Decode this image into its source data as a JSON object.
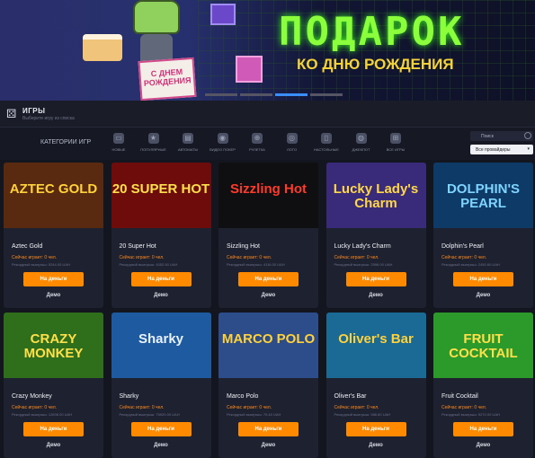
{
  "banner": {
    "title": "ПОДАРОК",
    "subtitle": "КО ДНЮ РОЖДЕНИЯ",
    "card_text": "С ДНЕМ РОЖДЕНИЯ",
    "slide_count": 4,
    "active_slide": 2
  },
  "games_section": {
    "title": "ИГРЫ",
    "subtitle": "Выберите игру из списка"
  },
  "categories": {
    "label": "КАТЕГОРИИ ИГР",
    "items": [
      {
        "label": "НОВЫЕ",
        "icon": "tv-icon"
      },
      {
        "label": "ПОПУЛЯРНЫЕ",
        "icon": "star-icon"
      },
      {
        "label": "АВТОМАТЫ",
        "icon": "slot-machine-icon"
      },
      {
        "label": "ВИДЕО ПОКЕР",
        "icon": "poker-chip-icon"
      },
      {
        "label": "РУЛЕТКА",
        "icon": "roulette-icon"
      },
      {
        "label": "ЛОТО",
        "icon": "lotto-icon"
      },
      {
        "label": "НАСТОЛЬНЫЕ",
        "icon": "card-icon"
      },
      {
        "label": "ДЖЕКПОТ",
        "icon": "jackpot-icon"
      },
      {
        "label": "ВСЕ ИГРЫ",
        "icon": "all-games-icon"
      }
    ]
  },
  "search": {
    "placeholder": "Поиск"
  },
  "providers": {
    "selected": "Все провайдеры"
  },
  "game_labels": {
    "playing_prefix": "Сейчас играет: 0 чел.",
    "play_for_money": "На деньги",
    "demo": "Демо"
  },
  "games": [
    {
      "name": "Aztec Gold",
      "logo": "AZTEC GOLD",
      "record": "Рекордный выигрыш: 5244.00 UAH",
      "bg": "#5a2a10",
      "logo_color": "#ffd23a"
    },
    {
      "name": "20 Super Hot",
      "logo": "20 SUPER HOT",
      "record": "Рекордный выигрыш: 4052.50 UAH",
      "bg": "#6e0c0c",
      "logo_color": "#ffe04a"
    },
    {
      "name": "Sizzling Hot",
      "logo": "Sizzling Hot",
      "record": "Рекордный выигрыш: 4116.00 UAH",
      "bg": "#0f0f12",
      "logo_color": "#ff3a2a"
    },
    {
      "name": "Lucky Lady's Charm",
      "logo": "Lucky Lady's Charm",
      "record": "Рекордный выигрыш: 2596.00 UAH",
      "bg": "#3a2a7a",
      "logo_color": "#ffd84a"
    },
    {
      "name": "Dolphin's Pearl",
      "logo": "DOLPHIN'S PEARL",
      "record": "Рекордный выигрыш: 2450.60 UAH",
      "bg": "#0d3a66",
      "logo_color": "#7fd4ff"
    },
    {
      "name": "Crazy Monkey",
      "logo": "CRAZY MONKEY",
      "record": "Рекордный выигрыш: 12696.00 UAH",
      "bg": "#2f6e1a",
      "logo_color": "#ffe04a"
    },
    {
      "name": "Sharky",
      "logo": "Sharky",
      "record": "Рекордный выигрыш: 75920.00 UAH",
      "bg": "#1e5aa0",
      "logo_color": "#e8f2ff"
    },
    {
      "name": "Marco Polo",
      "logo": "MARCO POLO",
      "record": "Рекордный выигрыш: 70.40 UAH",
      "bg": "#2d4c8a",
      "logo_color": "#ffd23a"
    },
    {
      "name": "Oliver's Bar",
      "logo": "Oliver's Bar",
      "record": "Рекордный выигрыш: 586.60 UAH",
      "bg": "#1b6a95",
      "logo_color": "#ffd23a"
    },
    {
      "name": "Fruit Cocktail",
      "logo": "FRUIT COCKTAIL",
      "record": "Рекордный выигрыш: 5270.00 UAH",
      "bg": "#2c9a2a",
      "logo_color": "#ffe04a"
    }
  ]
}
